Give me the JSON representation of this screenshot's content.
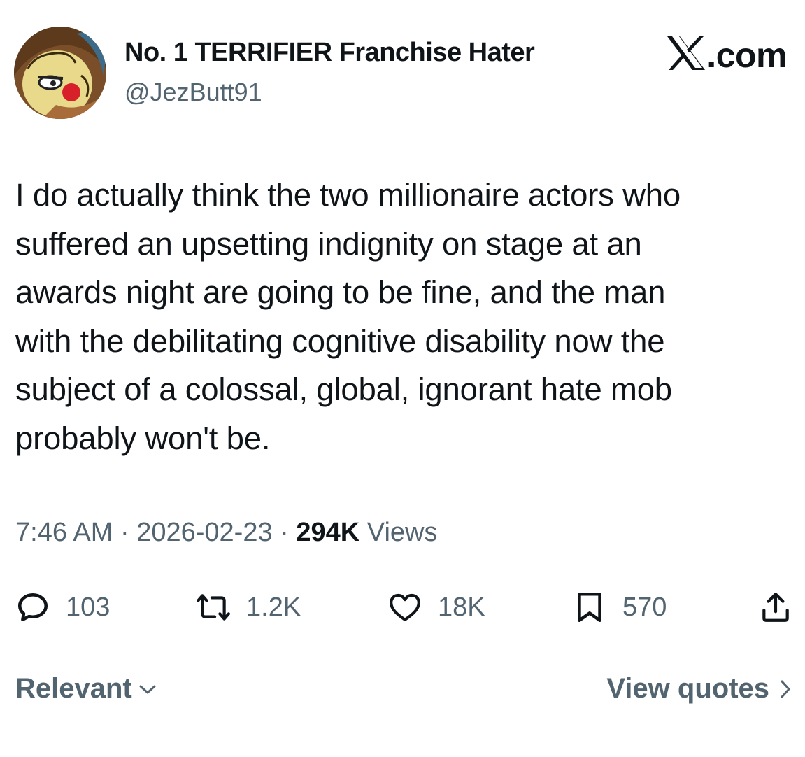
{
  "author": {
    "display_name": "No. 1 TERRIFIER Franchise Hater",
    "handle": "@JezButt91",
    "avatar_icon": "cartoon-clown-avatar"
  },
  "brand": {
    "label": ".com",
    "icon": "x-logo-icon"
  },
  "tweet": {
    "text": "I do actually think the two millionaire actors who\nsuffered an upsetting indignity on stage at an\nawards night are going to be fine, and the man\nwith the debilitating cognitive disability now the\nsubject of a colossal, global, ignorant hate mob\nprobably won't be.",
    "time": "7:46 AM",
    "separator": "·",
    "date": "2026-02-23",
    "views_count": "294K",
    "views_label": "Views"
  },
  "actions": {
    "replies": "103",
    "reposts": "1.2K",
    "likes": "18K",
    "bookmarks": "570"
  },
  "footer": {
    "sort_label": "Relevant",
    "view_quotes_label": "View quotes"
  },
  "colors": {
    "text": "#0f1419",
    "secondary": "#536471",
    "background": "#ffffff"
  }
}
